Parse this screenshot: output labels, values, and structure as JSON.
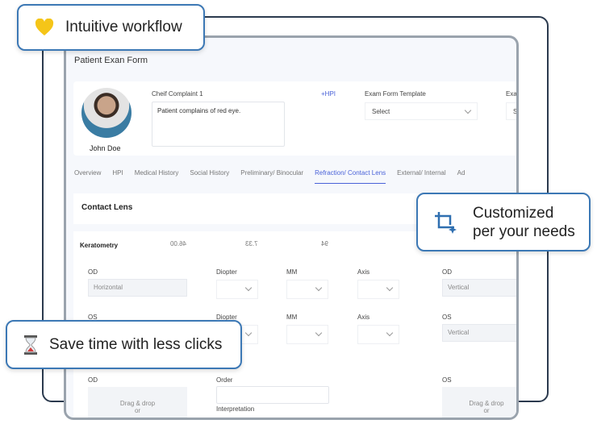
{
  "form": {
    "title": "Patient Exan Form",
    "patient_name": "John Doe",
    "complaint_label": "Cheif Complaint 1",
    "complaint_text": "Patient complains of red eye.",
    "hpi_link": "+HPI",
    "template_label": "Exam Form Template",
    "template_value": "Select",
    "exam_label": "Exa",
    "exam_value": "Se"
  },
  "tabs": [
    "Overview",
    "HPI",
    "Medical History",
    "Social History",
    "Preliminary/ Binocular",
    "Refraction/ Contact Lens",
    "External/ Internal",
    "Ad"
  ],
  "active_tab": "Refraction/ Contact Lens",
  "section": "Contact Lens",
  "keratometry": {
    "label": "Keratometry",
    "values": [
      "46.00",
      "7.33",
      "94"
    ]
  },
  "rows": [
    {
      "eye": "OD",
      "value": "Horizontal",
      "c1": "Diopter",
      "c2": "MM",
      "c3": "Axis",
      "eye2": "OD",
      "value2": "Vertical"
    },
    {
      "eye": "OS",
      "c1": "Diopter",
      "c2": "MM",
      "c3": "Axis",
      "eye2": "OS",
      "value2": "Vertical"
    }
  ],
  "bottom": {
    "od": "OD",
    "order": "Order",
    "os": "OS",
    "drag": "Drag & drop",
    "or": "or",
    "interpretation": "Interpretation"
  },
  "callouts": {
    "workflow": "Intuitive workflow",
    "custom_line1": "Customized",
    "custom_line2": "per your needs",
    "save": "Save time with less clicks"
  },
  "colors": {
    "accent": "#4a62d8",
    "callout_border": "#3c78b5",
    "heart": "#f5c518"
  }
}
